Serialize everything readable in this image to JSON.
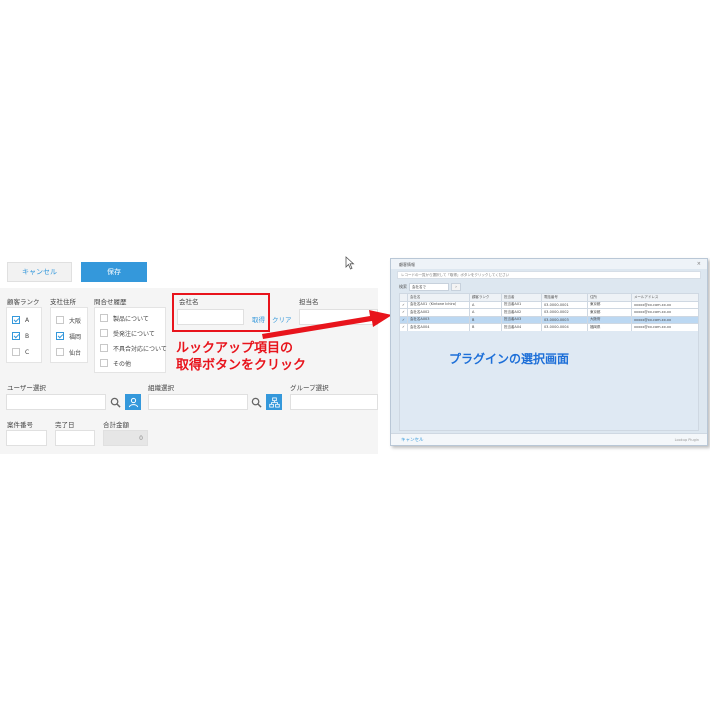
{
  "form": {
    "cancel_label": "キャンセル",
    "save_label": "保存",
    "fields": {
      "rank_label": "顧客ランク",
      "rank_options": [
        "A",
        "B",
        "C"
      ],
      "rank_checked": [
        true,
        true,
        false
      ],
      "support_label": "支社住所",
      "support_options": [
        "大阪",
        "福岡",
        "仙台"
      ],
      "support_checked": [
        false,
        true,
        false
      ],
      "history_label": "問合せ履歴",
      "history_options": [
        "製品について",
        "受発注について",
        "不具合対応について",
        "その他"
      ],
      "company_label": "会社名",
      "company_value": "",
      "get_label": "取得",
      "clear_label": "クリア",
      "contact_label": "担当名",
      "user_select_label": "ユーザー選択",
      "org_select_label": "組織選択",
      "group_select_label": "グループ選択",
      "case_no_label": "案件番号",
      "date_label": "完了日",
      "total_label": "合計金額",
      "total_value": "0"
    },
    "icons": {
      "search": "search-icon",
      "user": "user-icon",
      "org": "org-chart-icon"
    },
    "accent_color": "#3498db"
  },
  "annotations": {
    "lookup_caption_line1": "ルックアップ項目の",
    "lookup_caption_line2": "取得ボタンをクリック",
    "plugin_caption": "プラグインの選択画面",
    "annotation_color": "#e8141c",
    "plugin_caption_color": "#1d6fd8"
  },
  "dialog": {
    "title": "顧客情報",
    "close": "×",
    "breadcrumb": "レコードの一覧から選択して「取得」ボタンをクリックしてください",
    "search_label": "検索",
    "search_value": "会社名で",
    "search_button": "›",
    "columns": [
      "",
      "会社名",
      "顧客ランク",
      "担当者",
      "電話番号",
      "住所",
      "メールアドレス"
    ],
    "rows": [
      [
        "✓",
        "会社名A01（Kintone Ichiro）",
        "A",
        "担当者A01",
        "03-0000-0001",
        "東京都",
        "xxxxx@xx.com.xx.xx"
      ],
      [
        "✓",
        "会社名A002",
        "A",
        "担当者A02",
        "03-0000-0002",
        "東京都",
        "xxxxx@xx.com.xx.xx"
      ],
      [
        "✓",
        "会社名A003",
        "B",
        "担当者A03",
        "03-0000-0003",
        "大阪府",
        "xxxxx@xx.com.xx.xx"
      ],
      [
        "✓",
        "会社名A004",
        "B",
        "担当者A04",
        "03-0000-0004",
        "福岡県",
        "xxxxx@xx.com.xx.xx"
      ]
    ],
    "selected_row": 2,
    "cancel_label": "キャンセル",
    "credit": "Lookup Plugin"
  }
}
